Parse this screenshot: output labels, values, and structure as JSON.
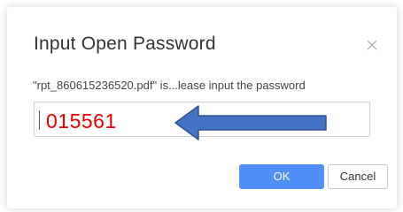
{
  "dialog": {
    "title": "Input Open Password",
    "message": "\"rpt_860615236520.pdf\" is...lease input the password",
    "password_annotation": "015561",
    "ok_label": "OK",
    "cancel_label": "Cancel",
    "close_icon": "close-icon",
    "arrow_icon": "left-arrow-icon"
  },
  "colors": {
    "primary_button": "#4f8ff7",
    "annotation_text": "#e60000",
    "arrow_fill": "#4472c4"
  }
}
